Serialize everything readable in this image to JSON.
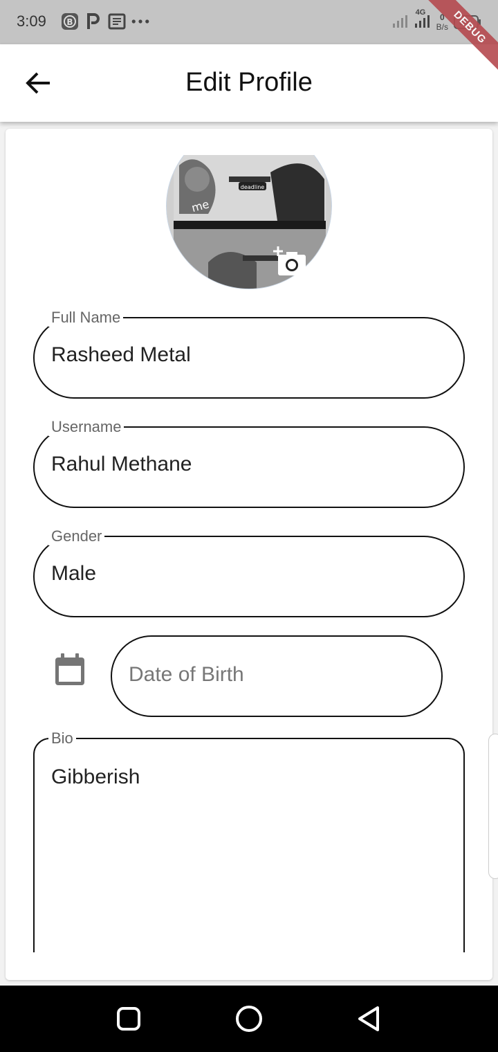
{
  "status_bar": {
    "time": "3:09",
    "network_type": "4G",
    "speed_value": "0",
    "speed_unit": "B/s",
    "battery": "80",
    "debug_banner": "DEBUG"
  },
  "app_bar": {
    "title": "Edit Profile"
  },
  "avatar": {
    "caption_top": "deadline",
    "caption_me": "me"
  },
  "form": {
    "full_name": {
      "label": "Full Name",
      "value": "Rasheed Metal"
    },
    "username": {
      "label": "Username",
      "value": "Rahul Methane"
    },
    "gender": {
      "label": "Gender",
      "value": "Male"
    },
    "date_of_birth": {
      "placeholder": "Date of Birth"
    },
    "bio": {
      "label": "Bio",
      "value": "Gibberish"
    }
  },
  "icons": {
    "back": "arrow-left-icon",
    "camera": "add-camera-icon",
    "calendar": "calendar-icon",
    "nav_recents": "square-icon",
    "nav_home": "circle-icon",
    "nav_back": "triangle-icon"
  }
}
